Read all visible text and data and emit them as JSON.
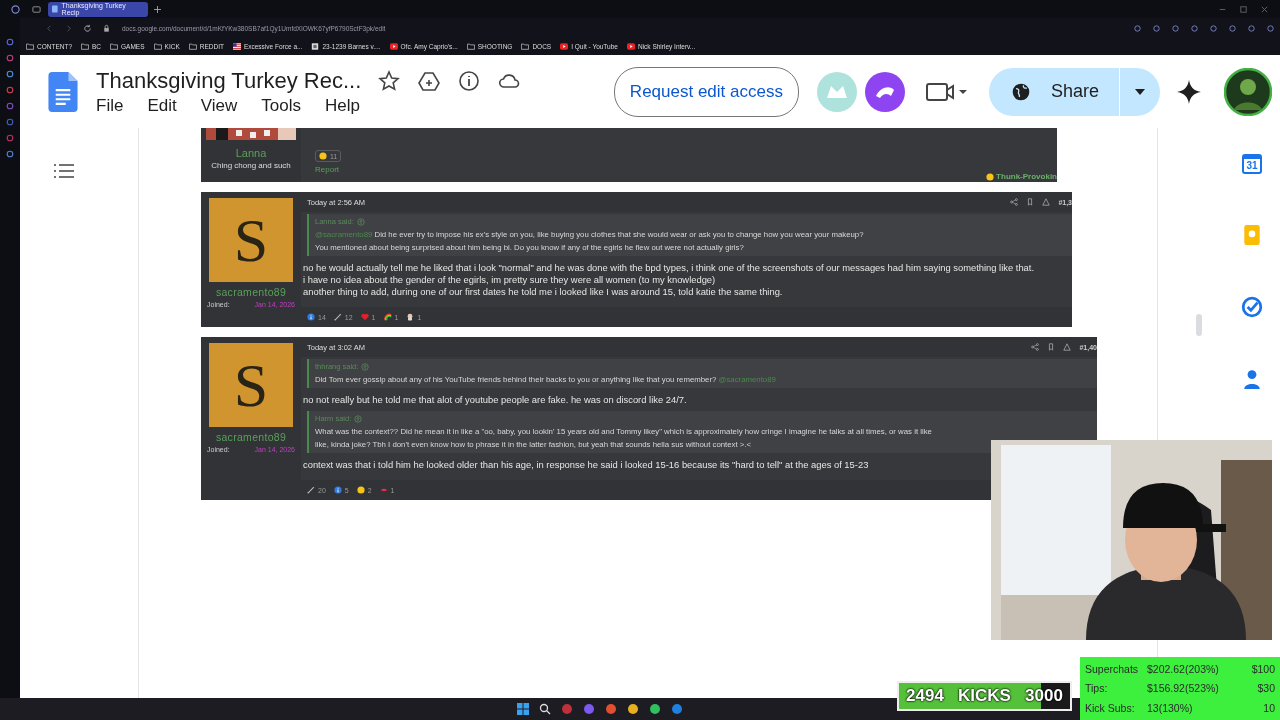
{
  "browser": {
    "tab_title": "Thanksgiving Turkey Recip",
    "url": "docs.google.com/document/d/1mKfYKw380SB7af1Qy1UmfdXlOWK67yfP6790SctF3pk/edit",
    "bookmarks": [
      {
        "label": "CONTENT?",
        "kind": "folder"
      },
      {
        "label": "BC",
        "kind": "folder"
      },
      {
        "label": "GAMES",
        "kind": "folder"
      },
      {
        "label": "KICK",
        "kind": "folder"
      },
      {
        "label": "REDDIT",
        "kind": "folder"
      },
      {
        "label": "Excessive Force a...",
        "kind": "flag"
      },
      {
        "label": "23-1239 Barnes v....",
        "kind": "page"
      },
      {
        "label": "Ofc. Amy Caprio's...",
        "kind": "video"
      },
      {
        "label": "SHOOTING",
        "kind": "folder"
      },
      {
        "label": "DOCS",
        "kind": "folder"
      },
      {
        "label": "I Quit - YouTube",
        "kind": "video"
      },
      {
        "label": "Nick Shirley Interv...",
        "kind": "video"
      }
    ]
  },
  "docs": {
    "title": "Thanksgiving Turkey Rec...",
    "menu": [
      "File",
      "Edit",
      "View",
      "Tools",
      "Help"
    ],
    "request_button": "Request edit access",
    "share_button": "Share"
  },
  "side_panel": {
    "calendar_day": "31"
  },
  "posts": [
    {
      "kind": "partial",
      "author": "Lanna",
      "user_title": "Ching chong and such",
      "reactions": [
        {
          "kind": "thinking",
          "count": "11"
        }
      ],
      "report": "Report",
      "badge": "Thunk-Provokin"
    },
    {
      "kind": "full",
      "avatar_letter": "S",
      "author": "sacramento89",
      "joined_label": "Joined:",
      "joined_date": "Jan 14, 2026",
      "time": "Today at 2:56 AM",
      "number": "#1,3",
      "blocks": [
        {
          "kind": "quote",
          "by": "Lanna said:",
          "paragraphs": [
            [
              {
                "kind": "mention",
                "text": "@sacramento89"
              },
              {
                "kind": "plain",
                "text": " Did he ever try to impose his ex's style on you, like buying you clothes that she would wear or ask you to change how you wear your makeup?"
              }
            ],
            [
              {
                "kind": "plain",
                "text": "You mentioned about being surprised about him being bi. Do you know if any of the egirls he flew out were not actually girls?"
              }
            ]
          ]
        },
        {
          "kind": "text",
          "lines": [
            "no he would actually tell me he liked that i look \"normal\" and he was done with the bpd types, i think one of the screenshots of our messages had him saying something like that.",
            "i have no idea about the gender of the egirls, im pretty sure they were all women (to my knowledge)",
            "another thing to add, during one of our first dates he told me i looked like I was around 15, told katie the same thing."
          ]
        }
      ],
      "reactions": [
        {
          "kind": "info",
          "count": "14"
        },
        {
          "kind": "link",
          "count": "12"
        },
        {
          "kind": "heart",
          "count": "1"
        },
        {
          "kind": "rainbow",
          "count": "1"
        },
        {
          "kind": "face",
          "count": "1"
        }
      ]
    },
    {
      "kind": "full",
      "avatar_letter": "S",
      "author": "sacramento89",
      "joined_label": "Joined:",
      "joined_date": "Jan 14, 2026",
      "time": "Today at 3:02 AM",
      "number": "#1,40",
      "blocks": [
        {
          "kind": "quote",
          "by": "thhrang said:",
          "paragraphs": [
            [
              {
                "kind": "plain",
                "text": "Did Tom ever gossip about any of his YouTube friends behind their backs to you or anything like that you remember? "
              },
              {
                "kind": "mention",
                "text": "@sacramento89"
              }
            ]
          ]
        },
        {
          "kind": "text",
          "lines": [
            "no not really but he told me that alot of youtube people are fake. he was on discord like 24/7."
          ]
        },
        {
          "kind": "quote",
          "by": "Harm said:",
          "paragraphs": [
            [
              {
                "kind": "plain",
                "text": "What was the context?? Did he mean it in like a \"oo, baby, you lookin' 15 years old and Tommy likey\" which is approximately how cringe I imagine he talks at all times, or was it like"
              }
            ],
            [
              {
                "kind": "plain",
                "text": "like, kinda joke? Tbh I don't even know how to phrase it in the latter fashion, but yeah that sounds hella sus without context >.<"
              }
            ]
          ]
        },
        {
          "kind": "text",
          "lines": [
            "context was that i told him he looked older than his age, in response he said i looked 15-16 because its \"hard to tell\" at the ages of 15-23"
          ]
        }
      ],
      "reactions": [
        {
          "kind": "link",
          "count": "20"
        },
        {
          "kind": "info",
          "count": "5"
        },
        {
          "kind": "thinking",
          "count": "2"
        },
        {
          "kind": "lips",
          "count": "1"
        }
      ]
    }
  ],
  "kicks": {
    "current": "2494",
    "label": "KICKS",
    "goal": "3000",
    "level": 0.83
  },
  "goals": [
    {
      "label": "Superchats",
      "amount": "$202.62(203%)",
      "target": "$100"
    },
    {
      "label": "Tips:",
      "amount": "$156.92(523%)",
      "target": "$30"
    },
    {
      "label": "Kick Subs:",
      "amount": "13(130%)",
      "target": "10"
    }
  ]
}
